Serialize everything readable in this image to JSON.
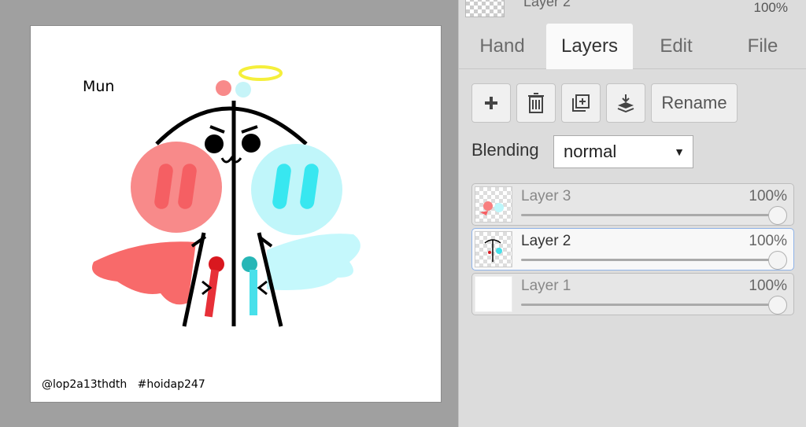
{
  "canvas": {
    "text_name": "Mun",
    "text_caption": "@lop2a13thdth   #hoidap247"
  },
  "top_layer_preview": {
    "name": "Layer 2",
    "opacity": "100%"
  },
  "tabs": [
    {
      "label": "Hand"
    },
    {
      "label": "Layers"
    },
    {
      "label": "Edit"
    },
    {
      "label": "File"
    }
  ],
  "toolbar": {
    "add_icon": "plus-icon",
    "delete_icon": "trash-icon",
    "duplicate_icon": "duplicate-icon",
    "merge_icon": "merge-down-icon",
    "rename_label": "Rename"
  },
  "blending": {
    "label": "Blending",
    "value": "normal"
  },
  "layers": [
    {
      "name": "Layer 3",
      "opacity": "100%"
    },
    {
      "name": "Layer 2",
      "opacity": "100%"
    },
    {
      "name": "Layer 1",
      "opacity": "100%"
    }
  ],
  "colors": {
    "panel_bg": "#dcdcdc",
    "selected_border": "#8fb3e8",
    "red": "#f87f7f",
    "cyan": "#bdf7fb"
  }
}
